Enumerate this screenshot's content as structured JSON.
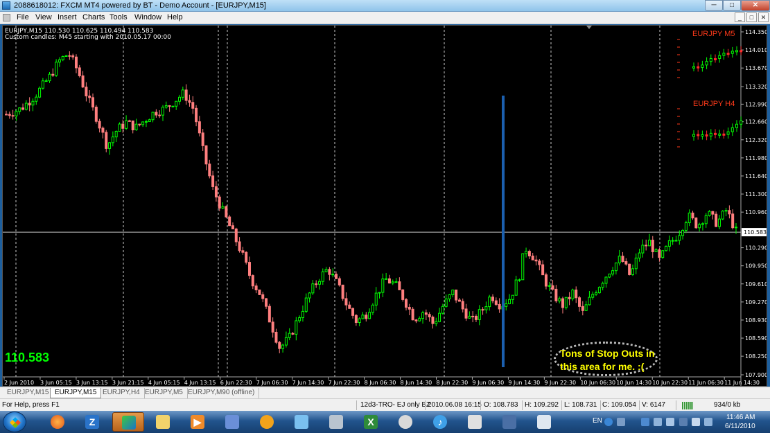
{
  "window": {
    "title": "2088618012: FXCM MT4 powered by BT - Demo Account - [EURJPY,M15]",
    "minimize": "─",
    "maximize": "□",
    "close": "✕"
  },
  "menu": [
    "File",
    "View",
    "Insert",
    "Charts",
    "Tools",
    "Window",
    "Help"
  ],
  "mdi_controls": [
    "_",
    "□",
    "✕"
  ],
  "chart_header": {
    "symbol_line": "EURJPY,M15  110.530 110.625 110.494 110.583",
    "custom_line": "Custom candles: M45 starting with 2010.05.17 00:00"
  },
  "current_price": "110.583",
  "annotation": {
    "line1": "Tons of Stop Outs in",
    "line2": "this area for me.  :("
  },
  "mini_chart_m5": {
    "title": "EURJPY M5"
  },
  "mini_chart_h4": {
    "title": "EURJPY H4"
  },
  "chart_data": {
    "type": "candlestick",
    "symbol": "EURJPY",
    "timeframe": "M15",
    "y_tick_labels": [
      "114.350",
      "114.010",
      "113.670",
      "113.320",
      "112.990",
      "112.660",
      "112.320",
      "111.980",
      "111.640",
      "111.300",
      "110.960",
      "110.290",
      "109.950",
      "109.610",
      "109.270",
      "108.930",
      "108.590",
      "108.250",
      "107.900"
    ],
    "y_ticks": [
      114.35,
      114.01,
      113.67,
      113.32,
      112.99,
      112.66,
      112.32,
      111.98,
      111.64,
      111.3,
      110.96,
      110.29,
      109.95,
      109.61,
      109.27,
      108.93,
      108.59,
      108.25,
      107.9
    ],
    "x_tick_labels": [
      "2 Jun 2010",
      "3 Jun 05:15",
      "3 Jun 13:15",
      "3 Jun 21:15",
      "4 Jun 05:15",
      "4 Jun 13:15",
      "6 Jun 22:30",
      "7 Jun 06:30",
      "7 Jun 14:30",
      "7 Jun 22:30",
      "8 Jun 06:30",
      "8 Jun 14:30",
      "8 Jun 22:30",
      "9 Jun 06:30",
      "9 Jun 14:30",
      "9 Jun 22:30",
      "10 Jun 06:30",
      "10 Jun 14:30",
      "10 Jun 22:30",
      "11 Jun 06:30",
      "11 Jun 14:30"
    ],
    "current_price": 110.583,
    "price_path": [
      [
        0,
        112.8
      ],
      [
        3,
        112.9
      ],
      [
        6,
        113.15
      ],
      [
        9,
        113.5
      ],
      [
        11,
        113.8
      ],
      [
        13,
        113.95
      ],
      [
        15,
        113.6
      ],
      [
        17,
        113.1
      ],
      [
        19,
        112.7
      ],
      [
        21,
        112.2
      ],
      [
        23,
        112.5
      ],
      [
        25,
        112.65
      ],
      [
        27,
        112.55
      ],
      [
        29,
        112.7
      ],
      [
        31,
        112.85
      ],
      [
        33,
        112.9
      ],
      [
        35,
        113.05
      ],
      [
        37,
        113.2
      ],
      [
        39,
        112.9
      ],
      [
        41,
        112.1
      ],
      [
        43,
        111.4
      ],
      [
        45,
        111.0
      ],
      [
        47,
        110.6
      ],
      [
        49,
        110.2
      ],
      [
        51,
        109.7
      ],
      [
        53,
        109.4
      ],
      [
        55,
        108.9
      ],
      [
        57,
        108.4
      ],
      [
        59,
        108.6
      ],
      [
        61,
        109.0
      ],
      [
        63,
        109.4
      ],
      [
        65,
        109.7
      ],
      [
        67,
        109.9
      ],
      [
        69,
        109.6
      ],
      [
        71,
        109.2
      ],
      [
        73,
        108.9
      ],
      [
        75,
        109.05
      ],
      [
        77,
        109.4
      ],
      [
        79,
        109.7
      ],
      [
        81,
        109.6
      ],
      [
        83,
        109.3
      ],
      [
        85,
        108.95
      ],
      [
        87,
        109.1
      ],
      [
        89,
        108.85
      ],
      [
        91,
        109.2
      ],
      [
        93,
        109.45
      ],
      [
        95,
        109.15
      ],
      [
        97,
        108.9
      ],
      [
        99,
        109.1
      ],
      [
        101,
        109.4
      ],
      [
        103,
        109.2
      ],
      [
        105,
        109.35
      ],
      [
        107,
        109.8
      ],
      [
        108,
        110.3
      ],
      [
        110,
        110.1
      ],
      [
        112,
        109.7
      ],
      [
        114,
        109.4
      ],
      [
        116,
        109.2
      ],
      [
        118,
        109.45
      ],
      [
        120,
        109.05
      ],
      [
        122,
        109.4
      ],
      [
        124,
        109.65
      ],
      [
        126,
        109.9
      ],
      [
        128,
        110.1
      ],
      [
        130,
        109.75
      ],
      [
        132,
        110.25
      ],
      [
        134,
        110.4
      ],
      [
        136,
        110.05
      ],
      [
        138,
        110.35
      ],
      [
        140,
        110.55
      ],
      [
        142,
        110.9
      ],
      [
        144,
        110.7
      ],
      [
        146,
        110.95
      ],
      [
        148,
        110.75
      ],
      [
        150,
        111.0
      ],
      [
        152,
        110.6
      ]
    ]
  },
  "tabs": [
    "EURJPY,M15",
    "EURJPY,M15",
    "EURJPY,H4",
    "EURJPY,M5",
    "EURJPY,M90 (offline)"
  ],
  "active_tab": 1,
  "status": {
    "help": "For Help, press F1",
    "profile": "12d3-TRO- EJ only BZ",
    "datetime": "2010.06.08 16:15",
    "open": "O: 108.783",
    "high": "H: 109.292",
    "low": "L: 108.731",
    "close": "C: 109.054",
    "volume": "V: 6147",
    "traffic": "934/0 kb"
  },
  "taskbar": {
    "lang": "EN",
    "time": "11:46 AM",
    "date": "6/11/2010"
  },
  "colors": {
    "bull": "#00ff00",
    "bear": "#ff7f7f",
    "grid": "#c8c8c8",
    "price_line": "#c8c8c8",
    "accent": "#00ff00"
  }
}
